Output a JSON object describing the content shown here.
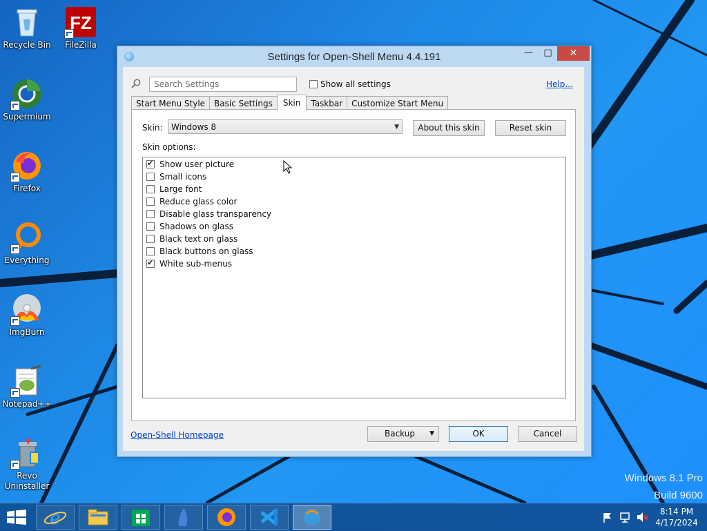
{
  "desktop": {
    "icons": [
      {
        "label": "Recycle Bin"
      },
      {
        "label": "FileZilla"
      },
      {
        "label": "Supermium"
      },
      {
        "label": "Firefox"
      },
      {
        "label": "Everything"
      },
      {
        "label": "ImgBurn"
      },
      {
        "label": "Notepad++"
      },
      {
        "label": "Revo\nUninstaller"
      }
    ],
    "watermark": {
      "line1": "Windows 8.1 Pro",
      "line2": "Build 9600"
    }
  },
  "window": {
    "title": "Settings for Open-Shell Menu 4.4.191",
    "search": {
      "placeholder": "Search Settings",
      "value": ""
    },
    "show_all_settings": {
      "label": "Show all settings",
      "checked": false
    },
    "help_link": "Help...",
    "tabs": [
      {
        "label": "Start Menu Style",
        "active": false
      },
      {
        "label": "Basic Settings",
        "active": false
      },
      {
        "label": "Skin",
        "active": true
      },
      {
        "label": "Taskbar",
        "active": false
      },
      {
        "label": "Customize Start Menu",
        "active": false
      }
    ],
    "skin": {
      "label": "Skin:",
      "selected": "Windows 8",
      "about_button": "About this skin",
      "reset_button": "Reset skin"
    },
    "skin_options": {
      "label": "Skin options:",
      "items": [
        {
          "label": "Show user picture",
          "checked": true
        },
        {
          "label": "Small icons",
          "checked": false
        },
        {
          "label": "Large font",
          "checked": false
        },
        {
          "label": "Reduce glass color",
          "checked": false
        },
        {
          "label": "Disable glass transparency",
          "checked": false
        },
        {
          "label": "Shadows on glass",
          "checked": false
        },
        {
          "label": "Black text on glass",
          "checked": false
        },
        {
          "label": "Black buttons on glass",
          "checked": false
        },
        {
          "label": "White sub-menus",
          "checked": true
        }
      ]
    },
    "homepage_link": "Open-Shell Homepage",
    "buttons": {
      "backup": "Backup",
      "ok": "OK",
      "cancel": "Cancel"
    }
  },
  "taskbar": {
    "items": [
      "internet-explorer",
      "file-explorer",
      "store",
      "app",
      "firefox",
      "visual-studio-code",
      "open-shell-settings"
    ],
    "clock": {
      "time": "8:14 PM",
      "date": "4/17/2024"
    }
  },
  "colors": {
    "close_button": "#c74b43",
    "link": "#0044cc",
    "accent": "#1e88e5"
  }
}
